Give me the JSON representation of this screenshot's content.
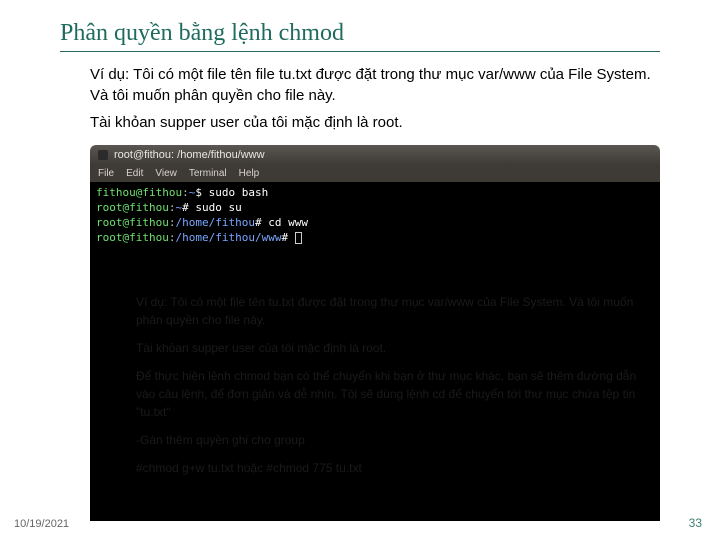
{
  "title": "Phân quyền bằng lệnh chmod",
  "body": {
    "line1": "Ví dụ: Tôi có một file tên file tu.txt được đặt trong thư mục var/www của File System. Và tôi muốn phân quyền cho file này.",
    "line2": "Tài khỏan supper user của tôi mặc định là root."
  },
  "terminal": {
    "title": "root@fithou: /home/fithou/www",
    "menu": [
      "File",
      "Edit",
      "View",
      "Terminal",
      "Help"
    ],
    "lines": {
      "l1_user": "fithou@fithou",
      "l1_sep": ":",
      "l1_path": "~",
      "l1_cmd": "$ sudo bash",
      "l2_user": "root@fithou",
      "l2_sep": ":",
      "l2_path": "~",
      "l2_cmd": "# sudo su",
      "l3_user": "root@fithou",
      "l3_sep": ":",
      "l3_path": "/home/fithou",
      "l3_cmd": "# cd www",
      "l4_user": "root@fithou",
      "l4_sep": ":",
      "l4_path": "/home/fithou/www",
      "l4_cmd": "# "
    },
    "ghost": {
      "p1": "Ví dụ: Tôi có một file tên tu.txt được đặt trong thư mục var/www của File System. Và tôi muốn phân quyền cho file này.",
      "p2": "Tài khỏan supper user của tôi mặc định là root.",
      "p3": "Để thực hiện lệnh chmod bạn có thể chuyển khi bạn ở thư mục khác, bạn sẽ thêm đường dẫn vào câu lệnh, để đơn giản và dễ nhìn. Tôi sẽ dùng lệnh cd để chuyển tới thư mục chứa tệp tin \"tu.txt\"",
      "p4": "-Gán thêm quyền ghi cho group",
      "p5": " #chmod g+w tu.txt  hoặc #chmod 775 tu.txt"
    }
  },
  "footer": {
    "date": "10/19/2021",
    "page": "33"
  }
}
